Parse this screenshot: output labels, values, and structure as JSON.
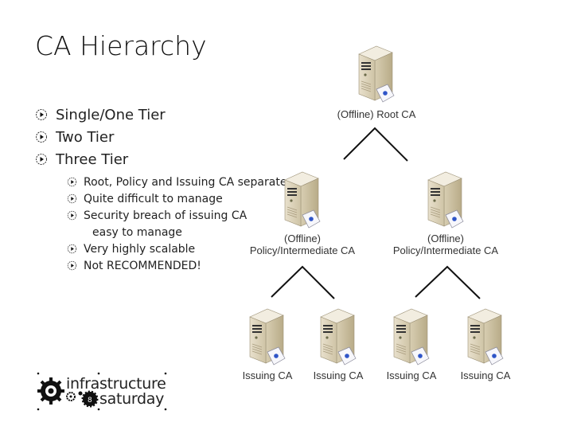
{
  "slide": {
    "title": "CA Hierarchy",
    "bullets": [
      {
        "text": "Single/One Tier",
        "icon": "circle-play-icon"
      },
      {
        "text": "Two Tier",
        "icon": "circle-play-icon"
      },
      {
        "text": "Three Tier",
        "icon": "circle-play-icon"
      }
    ],
    "sub_bullets": [
      {
        "text": "Root, Policy and Issuing CA separated"
      },
      {
        "text": "Quite difficult to manage"
      },
      {
        "text": "Security breach of issuing CA",
        "continuation": "easy to manage"
      },
      {
        "text": "Very highly scalable"
      },
      {
        "text": "Not RECOMMENDED!"
      }
    ]
  },
  "diagram": {
    "root": {
      "label": "(Offline) Root CA",
      "icon": "server-icon"
    },
    "intermediates": [
      {
        "label_line1": "(Offline)",
        "label_line2": "Policy/Intermediate CA",
        "icon": "server-icon"
      },
      {
        "label_line1": "(Offline)",
        "label_line2": "Policy/Intermediate CA",
        "icon": "server-icon"
      }
    ],
    "issuing": [
      {
        "label": "Issuing CA",
        "icon": "server-icon"
      },
      {
        "label": "Issuing CA",
        "icon": "server-icon"
      },
      {
        "label": "Issuing CA",
        "icon": "server-icon"
      },
      {
        "label": "Issuing CA",
        "icon": "server-icon"
      }
    ]
  },
  "logo": {
    "line1": "infrastructure",
    "line2": "saturday",
    "badge": "8"
  }
}
